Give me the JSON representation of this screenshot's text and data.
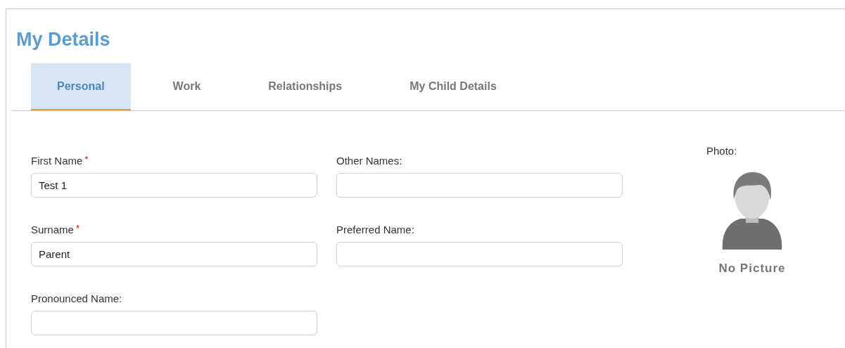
{
  "title": "My Details",
  "tabs": [
    {
      "label": "Personal",
      "selected": true
    },
    {
      "label": "Work",
      "selected": false
    },
    {
      "label": "Relationships",
      "selected": false
    },
    {
      "label": "My Child Details",
      "selected": false
    }
  ],
  "fields": [
    {
      "label": "First Name",
      "required": true,
      "value": "Test 1"
    },
    {
      "label": "Other Names:",
      "required": false
    },
    {
      "label": "Surname",
      "required": true,
      "value": "Parent"
    },
    {
      "label": "Preferred Name:",
      "required": false
    },
    {
      "label": "Pronounced Name:",
      "required": false
    }
  ],
  "required_mark": "*",
  "photo": {
    "label": "Photo:",
    "caption": "No Picture"
  }
}
